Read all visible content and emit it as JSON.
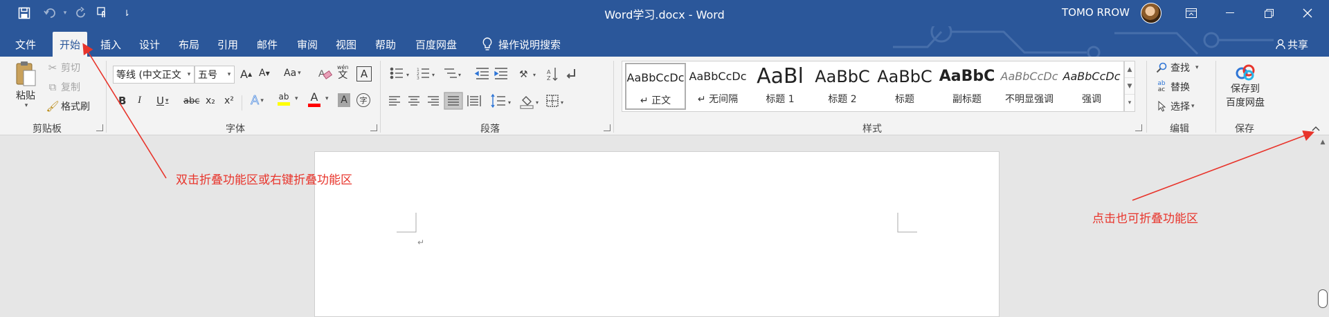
{
  "window": {
    "title": "Word学习.docx  -  Word",
    "user_name": "TOMO RROW",
    "qat_more": "⇂"
  },
  "tabs": [
    "文件",
    "开始",
    "插入",
    "设计",
    "布局",
    "引用",
    "邮件",
    "审阅",
    "视图",
    "帮助",
    "百度网盘"
  ],
  "tell_me": "操作说明搜索",
  "share": "共享",
  "clipboard": {
    "paste": "粘贴",
    "cut": "剪切",
    "copy": "复制",
    "format_painter": "格式刷",
    "label": "剪贴板"
  },
  "font": {
    "name": "等线 (中文正文",
    "size": "五号",
    "grow": "A",
    "shrink": "A",
    "case": "Aa",
    "phonetic": "wén",
    "phonetic_char": "文",
    "border_char": "A",
    "bold": "B",
    "italic": "I",
    "underline": "U",
    "strike": "abc",
    "subscript": "x₂",
    "superscript": "x²",
    "effects": "A",
    "highlight": "ab",
    "color": "A",
    "shading": "A",
    "enclose": "字",
    "label": "字体"
  },
  "paragraph": {
    "label": "段落"
  },
  "styles": {
    "label": "样式",
    "items": [
      {
        "sample": "AaBbCcDc",
        "name": "↵ 正文"
      },
      {
        "sample": "AaBbCcDc",
        "name": "↵ 无间隔"
      },
      {
        "sample": "AaBl",
        "name": "标题 1"
      },
      {
        "sample": "AaBbC",
        "name": "标题 2"
      },
      {
        "sample": "AaBbC",
        "name": "标题"
      },
      {
        "sample": "AaBbC",
        "name": "副标题"
      },
      {
        "sample": "AaBbCcDc",
        "name": "不明显强调"
      },
      {
        "sample": "AaBbCcDc",
        "name": "强调"
      }
    ]
  },
  "editing": {
    "find": "查找",
    "replace": "替换",
    "select": "选择",
    "label": "编辑"
  },
  "save_group": {
    "line1": "保存到",
    "line2": "百度网盘",
    "label": "保存"
  },
  "document": {
    "paragraph_mark": "↵"
  },
  "annotations": {
    "left": "双击折叠功能区或右键折叠功能区",
    "right": "点击也可折叠功能区"
  },
  "colors": {
    "brand": "#2b579a",
    "annotation": "#e8342b",
    "highlight": "#ffff00",
    "font_color": "#ff0000"
  }
}
